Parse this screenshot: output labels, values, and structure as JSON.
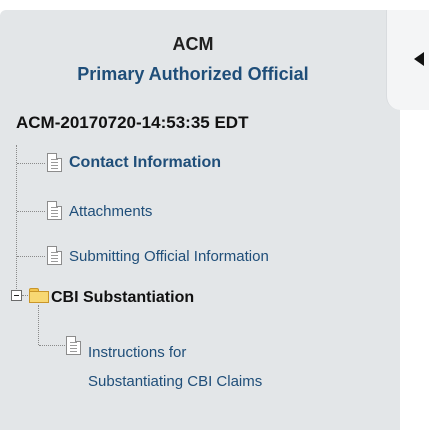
{
  "header": {
    "org": "ACM",
    "role": "Primary Authorized Official",
    "submission_id": "ACM-20170720-14:53:35 EDT"
  },
  "tree": {
    "contact": "Contact Information",
    "attachments": "Attachments",
    "submitting": "Submitting Official Information",
    "cbi": "CBI Substantiation",
    "instructions_line1": "Instructions for",
    "instructions_line2": "Substantiating CBI Claims"
  },
  "icons": {
    "collapse": "chevron-left-icon",
    "document": "document-icon",
    "folder": "folder-open-icon",
    "expander": "minus-box-icon"
  },
  "colors": {
    "panel_bg": "#e3e6e8",
    "link": "#1f4e79",
    "folder": "#f8d873"
  }
}
